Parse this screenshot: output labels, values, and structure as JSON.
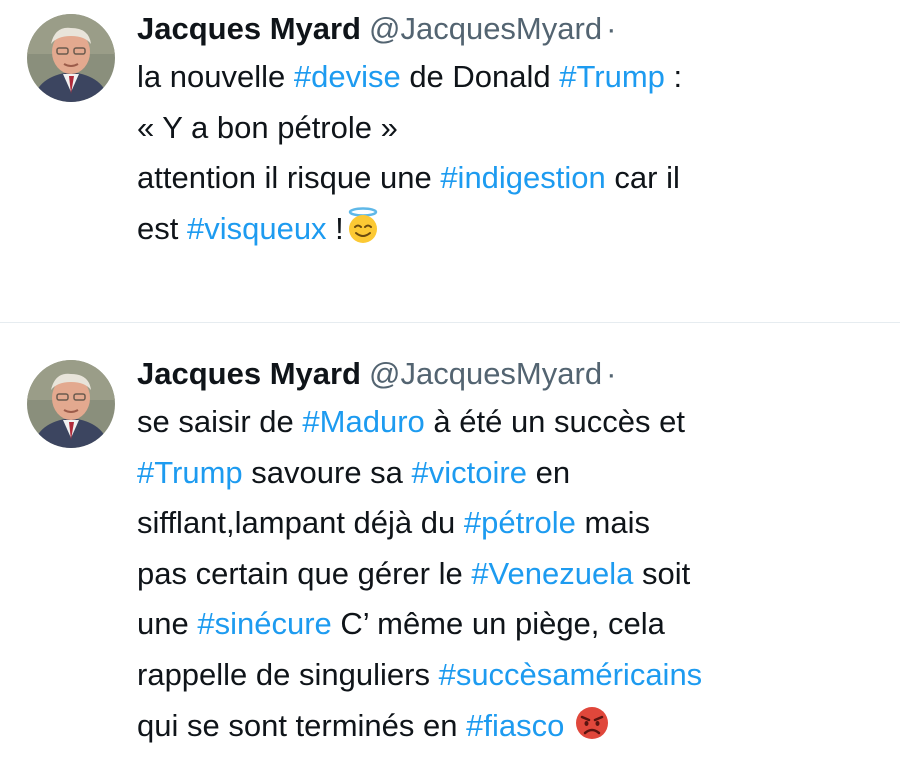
{
  "tweets": [
    {
      "author": {
        "name": "Jacques Myard",
        "handle": "@JacquesMyard",
        "sep": "·"
      },
      "lines": [
        [
          {
            "t": "text",
            "v": "la nouvelle "
          },
          {
            "t": "tag",
            "v": "#devise"
          },
          {
            "t": "text",
            "v": " de Donald "
          },
          {
            "t": "tag",
            "v": "#Trump"
          },
          {
            "t": "text",
            "v": " :"
          }
        ],
        [
          {
            "t": "text",
            "v": "« Y a bon pétrole »"
          }
        ],
        [
          {
            "t": "text",
            "v": "attention il risque une "
          },
          {
            "t": "tag",
            "v": "#indigestion"
          },
          {
            "t": "text",
            "v": " car il"
          }
        ],
        [
          {
            "t": "text",
            "v": "est "
          },
          {
            "t": "tag",
            "v": "#visqueux"
          },
          {
            "t": "text",
            "v": " !"
          },
          {
            "t": "emoji",
            "v": "smiling-face-with-halo-icon"
          }
        ]
      ]
    },
    {
      "author": {
        "name": "Jacques Myard",
        "handle": "@JacquesMyard",
        "sep": "·"
      },
      "lines": [
        [
          {
            "t": "text",
            "v": "se saisir de "
          },
          {
            "t": "tag",
            "v": "#Maduro"
          },
          {
            "t": "text",
            "v": " à été un succès et"
          }
        ],
        [
          {
            "t": "tag",
            "v": "#Trump"
          },
          {
            "t": "text",
            "v": " savoure sa "
          },
          {
            "t": "tag",
            "v": "#victoire"
          },
          {
            "t": "text",
            "v": " en"
          }
        ],
        [
          {
            "t": "text",
            "v": "sifflant,lampant déjà du "
          },
          {
            "t": "tag",
            "v": "#pétrole"
          },
          {
            "t": "text",
            "v": " mais"
          }
        ],
        [
          {
            "t": "text",
            "v": "pas certain que gérer le "
          },
          {
            "t": "tag",
            "v": "#Venezuela"
          },
          {
            "t": "text",
            "v": " soit"
          }
        ],
        [
          {
            "t": "text",
            "v": "une "
          },
          {
            "t": "tag",
            "v": "#sinécure"
          },
          {
            "t": "text",
            "v": " C’ même un piège, cela"
          }
        ],
        [
          {
            "t": "text",
            "v": "rappelle de singuliers "
          },
          {
            "t": "tag",
            "v": "#succèsaméricains"
          }
        ],
        [
          {
            "t": "text",
            "v": "qui se sont terminés en "
          },
          {
            "t": "tag",
            "v": "#fiasco"
          },
          {
            "t": "text",
            "v": " "
          },
          {
            "t": "emoji",
            "v": "angry-face-icon"
          }
        ]
      ]
    }
  ],
  "colors": {
    "hashtag": "#1d9bf0",
    "text": "#0f1419",
    "secondary": "#536471"
  }
}
